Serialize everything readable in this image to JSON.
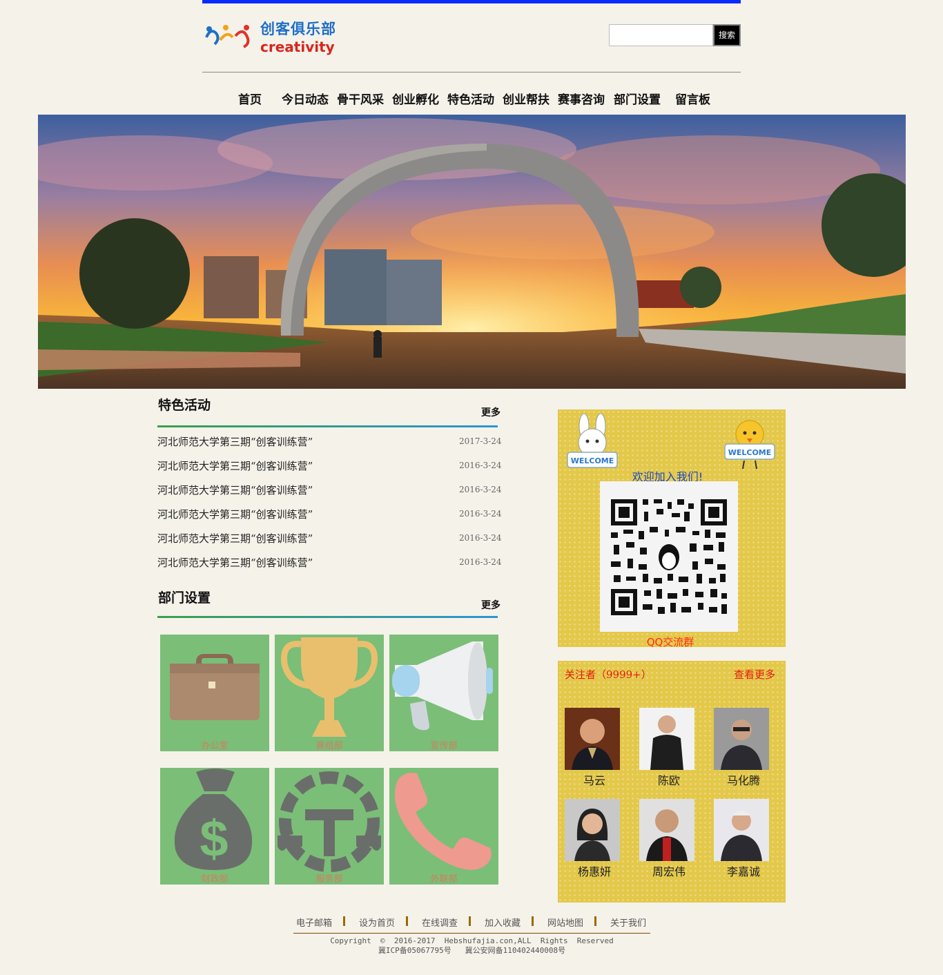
{
  "header": {
    "logo_cn": "创客俱乐部",
    "logo_en": "creativity",
    "search_placeholder": "",
    "search_button": "搜索"
  },
  "nav": [
    "首页",
    "今日动态",
    "骨干风采",
    "创业孵化",
    "特色活动",
    "创业帮扶",
    "赛事咨询",
    "部门设置",
    "留言板"
  ],
  "features": {
    "title": "特色活动",
    "more": "更多",
    "items": [
      {
        "title": "河北师范大学第三期“创客训练营”",
        "date": "2017-3-24"
      },
      {
        "title": "河北师范大学第三期“创客训练营”",
        "date": "2016-3-24"
      },
      {
        "title": "河北师范大学第三期“创客训练营”",
        "date": "2016-3-24"
      },
      {
        "title": "河北师范大学第三期“创客训练营”",
        "date": "2016-3-24"
      },
      {
        "title": "河北师范大学第三期“创客训练营”",
        "date": "2016-3-24"
      },
      {
        "title": "河北师范大学第三期“创客训练营”",
        "date": "2016-3-24"
      }
    ]
  },
  "departments": {
    "title": "部门设置",
    "more": "更多",
    "items": [
      {
        "label": "办公室",
        "icon": "briefcase-icon"
      },
      {
        "label": "赛组部",
        "icon": "trophy-icon"
      },
      {
        "label": "宣传部",
        "icon": "megaphone-icon"
      },
      {
        "label": "财政部",
        "icon": "money-bag-icon"
      },
      {
        "label": "服务部",
        "icon": "tools-icon"
      },
      {
        "label": "外联部",
        "icon": "phone-icon"
      }
    ]
  },
  "join": {
    "welcome": "欢迎加入我们!",
    "badge": "WELCOME",
    "qq_group": "QQ交流群"
  },
  "followers": {
    "label": "关注者（9999+）",
    "more": "查看更多",
    "people": [
      "马云",
      "陈欧",
      "马化腾",
      "杨惠妍",
      "周宏伟",
      "李嘉诚"
    ]
  },
  "footer": {
    "links": [
      "电子邮箱",
      "设为首页",
      "在线调查",
      "加入收藏",
      "网站地图",
      "关于我们"
    ],
    "copyright": "Copyright  ©  2016-2017  Hebshufajia.con,ALL  Rights  Reserved",
    "icp": "冀ICP备05067795号   冀公安网备110402440008号"
  },
  "colors": {
    "top_bar": "#0a2bff",
    "section_line_start": "#3aa04a",
    "section_line_end": "#2a96d6",
    "dept_tile": "#7bbe78",
    "panel": "#e3c84a"
  }
}
